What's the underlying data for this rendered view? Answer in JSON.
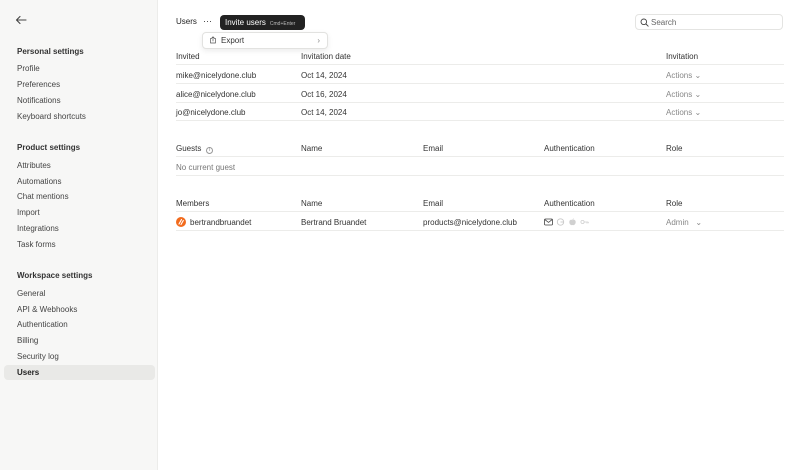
{
  "sidebar": {
    "back_icon": "arrow-left-icon",
    "sections": [
      {
        "title": "Personal settings",
        "items": [
          "Profile",
          "Preferences",
          "Notifications",
          "Keyboard shortcuts"
        ]
      },
      {
        "title": "Product settings",
        "items": [
          "Attributes",
          "Automations",
          "Chat mentions",
          "Import",
          "Integrations",
          "Task forms"
        ]
      },
      {
        "title": "Workspace settings",
        "items": [
          "General",
          "API & Webhooks",
          "Authentication",
          "Billing",
          "Security log",
          "Users"
        ]
      }
    ],
    "active_item": "Users"
  },
  "header": {
    "title": "Users",
    "more_label": "···",
    "invite_label": "Invite users",
    "invite_shortcut": "Cmd+Enter",
    "search_placeholder": "Search"
  },
  "dropdown": {
    "export_label": "Export",
    "chevron": "›"
  },
  "invited": {
    "headers": [
      "Invited",
      "Invitation date",
      "Invitation"
    ],
    "rows": [
      {
        "email": "mike@nicelydone.club",
        "date": "Oct 14, 2024",
        "action": "Actions ⌄"
      },
      {
        "email": "alice@nicelydone.club",
        "date": "Oct 16, 2024",
        "action": "Actions ⌄"
      },
      {
        "email": "jo@nicelydone.club",
        "date": "Oct 14, 2024",
        "action": "Actions ⌄"
      }
    ]
  },
  "guests": {
    "headers": [
      "Guests",
      "Name",
      "Email",
      "Authentication",
      "Role"
    ],
    "info_icon": "i",
    "empty_text": "No current guest"
  },
  "members": {
    "headers": [
      "Members",
      "Name",
      "Email",
      "Authentication",
      "Role"
    ],
    "rows": [
      {
        "username": "bertrandbruandet",
        "name": "Bertrand Bruandet",
        "email": "products@nicelydone.club",
        "role": "Admin",
        "role_chevron": "⌄"
      }
    ]
  },
  "colors": {
    "accent_dark": "#222222",
    "avatar": "#f26b1d",
    "sidebar_bg": "#f7f7f6"
  }
}
